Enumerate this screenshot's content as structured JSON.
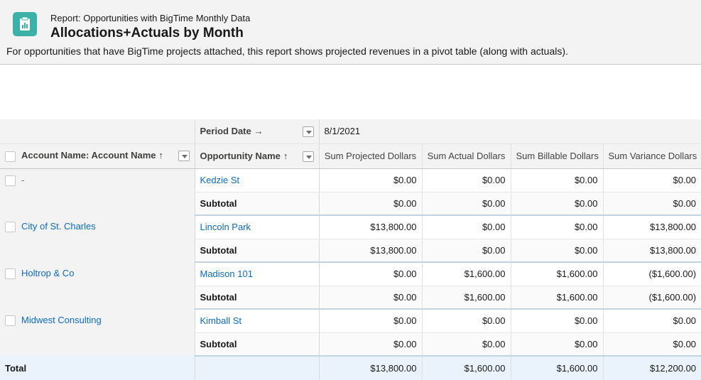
{
  "header": {
    "report_type": "Report: Opportunities with BigTime Monthly Data",
    "title": "Allocations+Actuals by Month",
    "description": "For opportunities that have BigTime projects attached, this report shows projected revenues in a pivot table (along with actuals)."
  },
  "table": {
    "period_label": "Period Date",
    "period_arrow": "→",
    "period_value": "8/1/2021",
    "col_account": "Account Name: Account Name",
    "col_opportunity": "Opportunity Name",
    "sort_arrow": "↑",
    "cols": [
      "Sum Projected Dollars",
      "Sum Actual Dollars",
      "Sum Billable Dollars",
      "Sum Variance Dollars"
    ],
    "groups": [
      {
        "account": "-",
        "opportunity": "Kedzie St",
        "values": [
          "$0.00",
          "$0.00",
          "$0.00",
          "$0.00"
        ],
        "subtotal_label": "Subtotal",
        "subtotal": [
          "$0.00",
          "$0.00",
          "$0.00",
          "$0.00"
        ]
      },
      {
        "account": "City of St. Charles",
        "opportunity": "Lincoln Park",
        "values": [
          "$13,800.00",
          "$0.00",
          "$0.00",
          "$13,800.00"
        ],
        "subtotal_label": "Subtotal",
        "subtotal": [
          "$13,800.00",
          "$0.00",
          "$0.00",
          "$13,800.00"
        ]
      },
      {
        "account": "Holtrop & Co",
        "opportunity": "Madison 101",
        "values": [
          "$0.00",
          "$1,600.00",
          "$1,600.00",
          "($1,600.00)"
        ],
        "subtotal_label": "Subtotal",
        "subtotal": [
          "$0.00",
          "$1,600.00",
          "$1,600.00",
          "($1,600.00)"
        ]
      },
      {
        "account": "Midwest Consulting",
        "opportunity": "Kimball St",
        "values": [
          "$0.00",
          "$0.00",
          "$0.00",
          "$0.00"
        ],
        "subtotal_label": "Subtotal",
        "subtotal": [
          "$0.00",
          "$0.00",
          "$0.00",
          "$0.00"
        ]
      }
    ],
    "total_label": "Total",
    "total": [
      "$13,800.00",
      "$1,600.00",
      "$1,600.00",
      "$12,200.00"
    ]
  }
}
